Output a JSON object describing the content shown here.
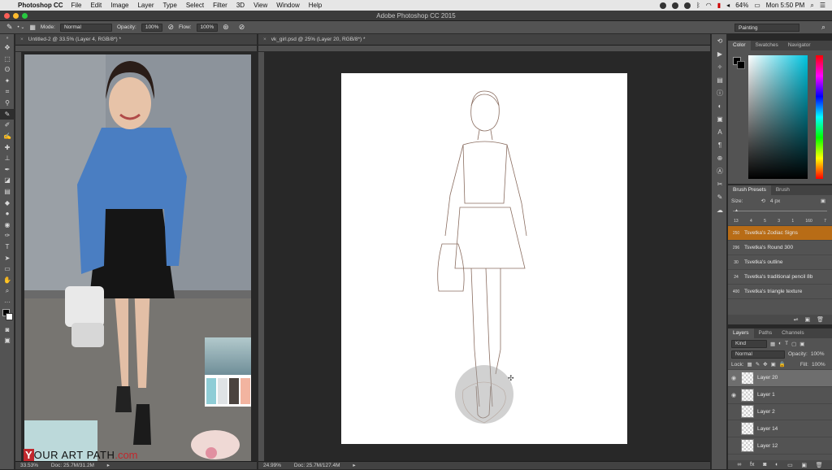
{
  "menubar": {
    "app": "Photoshop CC",
    "items": [
      "File",
      "Edit",
      "Image",
      "Layer",
      "Type",
      "Select",
      "Filter",
      "3D",
      "View",
      "Window",
      "Help"
    ],
    "battery": "64%",
    "clock": "Mon 5:50 PM"
  },
  "titlebar": {
    "title": "Adobe Photoshop CC 2015"
  },
  "options": {
    "mode_label": "Mode:",
    "mode_value": "Normal",
    "opacity_label": "Opacity:",
    "opacity_value": "100%",
    "flow_label": "Flow:",
    "flow_value": "100%",
    "workspace": "Painting"
  },
  "left_doc": {
    "tab": "Untitled-2 @ 33.5% (Layer 4, RGB/8*) *",
    "zoom": "33.53%",
    "doc": "Doc: 25.7M/31.2M"
  },
  "main_doc": {
    "tab": "vk_girl.psd @ 25% (Layer 20, RGB/8*) *",
    "zoom": "24.99%",
    "doc": "Doc: 25.7M/127.4M"
  },
  "watermark": {
    "y": "Y",
    "rest": "OUR ART PATH",
    "com": ".com"
  },
  "color_panel": {
    "tabs": [
      "Color",
      "Swatches",
      "Navigator"
    ],
    "hue_color": "#00c4e0"
  },
  "brush_panel": {
    "tabs": [
      "Brush Presets",
      "Brush"
    ],
    "size_label": "Size:",
    "size_value": "4 px",
    "thumb_sizes": [
      "13",
      "4",
      "5",
      "3",
      "1",
      "160",
      "7"
    ],
    "presets": [
      {
        "size": "250",
        "name": "Tsvetka's Zodiac Signs",
        "selected": true
      },
      {
        "size": "296",
        "name": "Tsvetka's Round 300",
        "selected": false
      },
      {
        "size": "30",
        "name": "Tsvetka's outline",
        "selected": false
      },
      {
        "size": "24",
        "name": "Tsvetka's traditional pencil 8b",
        "selected": false
      },
      {
        "size": "400",
        "name": "Tsvetka's triangle texture",
        "selected": false
      }
    ]
  },
  "layers_panel": {
    "tabs": [
      "Layers",
      "Paths",
      "Channels"
    ],
    "kind": "Kind",
    "blend": "Normal",
    "opacity_label": "Opacity:",
    "opacity_value": "100%",
    "lock_label": "Lock:",
    "fill_label": "Fill:",
    "fill_value": "100%",
    "layers": [
      {
        "name": "Layer 20",
        "visible": true,
        "selected": true
      },
      {
        "name": "Layer 1",
        "visible": true,
        "selected": false
      },
      {
        "name": "Layer 2",
        "visible": false,
        "selected": false
      },
      {
        "name": "Layer 14",
        "visible": false,
        "selected": false
      },
      {
        "name": "Layer 12",
        "visible": false,
        "selected": false
      }
    ]
  },
  "swatch_colors": [
    "#8fcdd6",
    "#dfe3e5",
    "#4b433e",
    "#f2b4a0"
  ]
}
